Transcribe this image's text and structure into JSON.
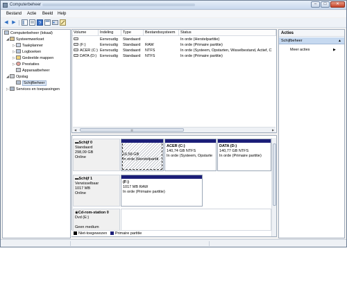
{
  "window": {
    "title": "Computerbeheer"
  },
  "menu": [
    "Bestand",
    "Actie",
    "Beeld",
    "Help"
  ],
  "tree": {
    "items": [
      {
        "label": "Computerbeheer (lokaal)",
        "level": 0,
        "expander": ""
      },
      {
        "label": "Systeemwerkset",
        "level": 1,
        "expander": "◢"
      },
      {
        "label": "Taakplanner",
        "level": 2,
        "expander": "▷"
      },
      {
        "label": "Logboeken",
        "level": 2,
        "expander": "▷"
      },
      {
        "label": "Gedeelde mappen",
        "level": 2,
        "expander": "▷"
      },
      {
        "label": "Prestaties",
        "level": 2,
        "expander": "▷"
      },
      {
        "label": "Apparaatbeheer",
        "level": 2,
        "expander": ""
      },
      {
        "label": "Opslag",
        "level": 1,
        "expander": "◢"
      },
      {
        "label": "Schijfbeheer",
        "level": 2,
        "expander": "",
        "selected": true
      },
      {
        "label": "Services en toepassingen",
        "level": 1,
        "expander": "▷"
      }
    ]
  },
  "volumes": {
    "headers": [
      "Volume",
      "Indeling",
      "Type",
      "Bestandssysteem",
      "Status"
    ],
    "rows": [
      [
        "",
        "Eenvoudig",
        "Standaard",
        "",
        "In orde (Herstelpartitie)"
      ],
      [
        "(F:)",
        "Eenvoudig",
        "Standaard",
        "RAW",
        "In orde (Primaire partitie)"
      ],
      [
        "ACER (C:)",
        "Eenvoudig",
        "Standaard",
        "NTFS",
        "In orde (Systeem, Opstarten, Wisselbestand, Actief, C"
      ],
      [
        "DATA (D:)",
        "Eenvoudig",
        "Standaard",
        "NTFS",
        "In orde (Primaire partitie)"
      ]
    ]
  },
  "disks": [
    {
      "name": "Schijf 0",
      "type": "Standaard",
      "size": "298,09 GB",
      "state": "Online",
      "partitions": [
        {
          "title": "",
          "size": "16,58 GB",
          "status": "In orde (Herstelpartiti"
        },
        {
          "title": "ACER (C:)",
          "size": "140,74 GB NTFS",
          "status": "In orde (Systeem, Opstarte"
        },
        {
          "title": "DATA (D:)",
          "size": "140,77 GB NTFS",
          "status": "In orde (Primaire partitie)"
        }
      ]
    },
    {
      "name": "Schijf 1",
      "type": "Verwisselbaar",
      "size": "1017 MB",
      "state": "Online",
      "partitions": [
        {
          "title": "(F:)",
          "size": "1017 MB RAW",
          "status": "In orde (Primaire partitie)"
        }
      ]
    },
    {
      "name": "Cd-rom-station 0",
      "type": "Dvd (E:)",
      "size": "",
      "state": "Geen medium",
      "partitions": []
    }
  ],
  "legend": [
    {
      "label": "Niet-toegewezen",
      "color": "#000000"
    },
    {
      "label": "Primaire partitie",
      "color": "#1b1e78"
    }
  ],
  "actions": {
    "title": "Acties",
    "group": "Schijfbeheer",
    "item": "Meer acties"
  }
}
